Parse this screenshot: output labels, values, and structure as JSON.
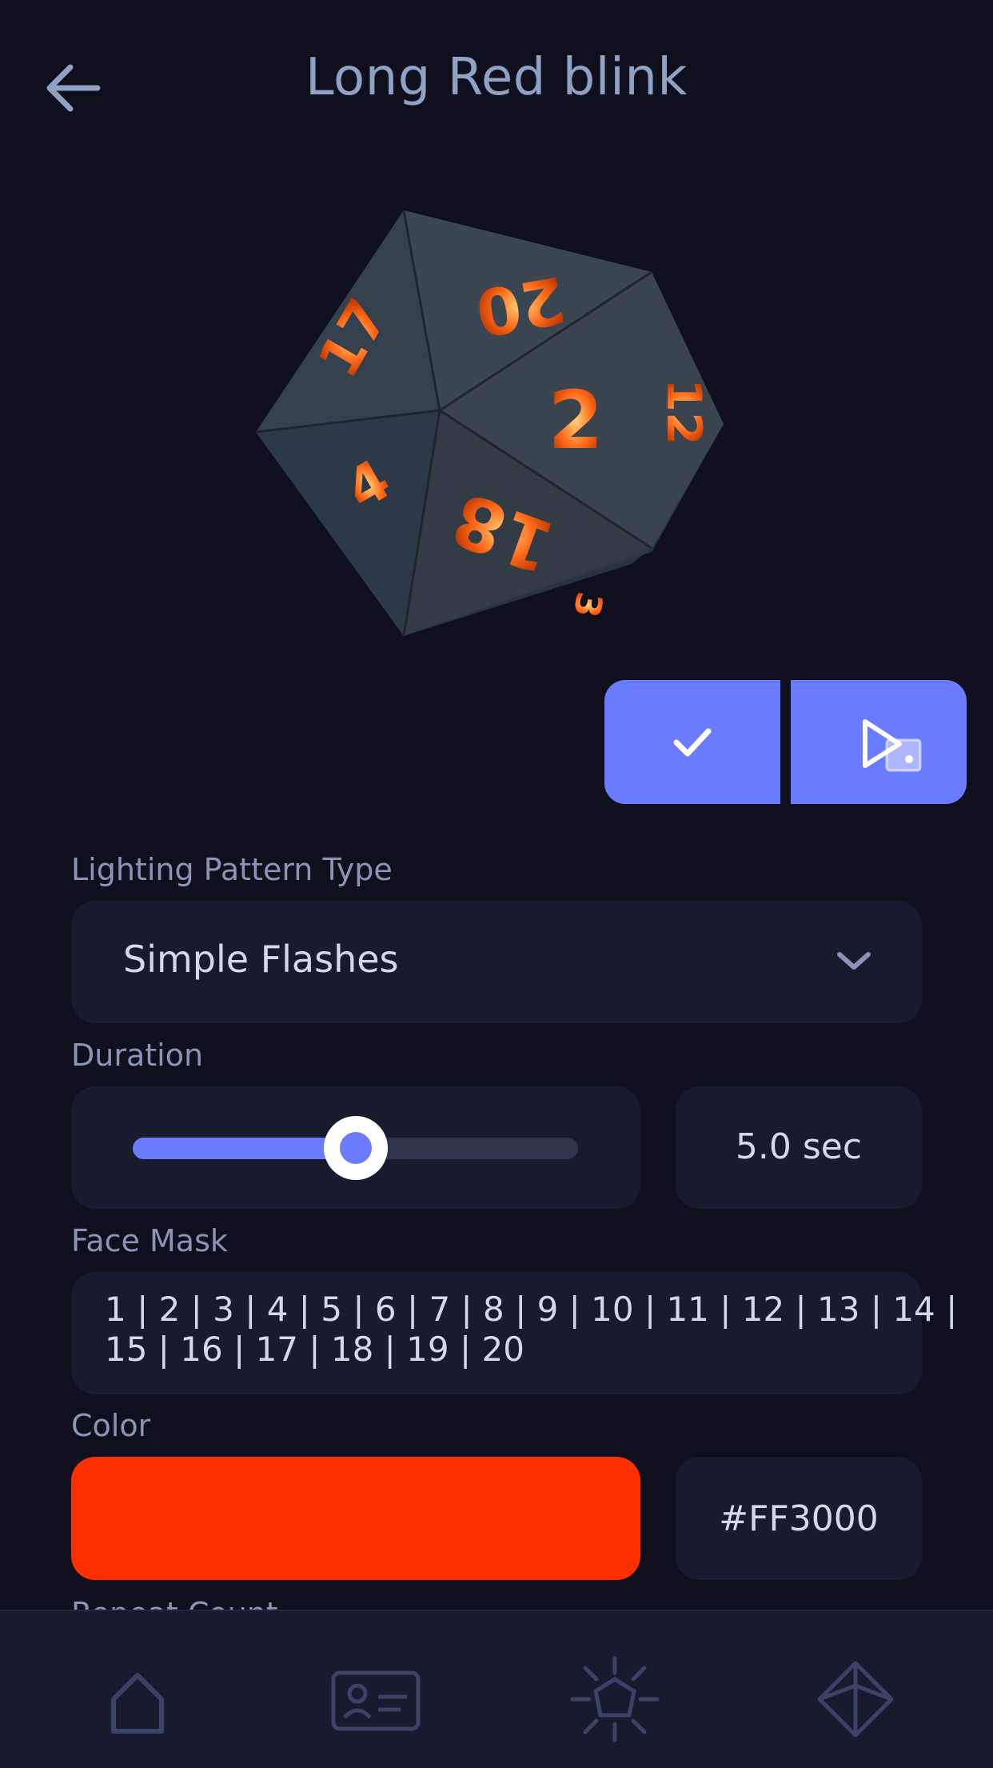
{
  "header": {
    "title": "Long Red blink",
    "back_icon": "arrow-left-icon"
  },
  "preview": {
    "die_type": "d20",
    "visible_numbers": [
      "20",
      "17",
      "2",
      "12",
      "4",
      "18",
      "3"
    ],
    "accent": "#ff6a1a"
  },
  "actions": {
    "apply_icon": "checkmark-icon",
    "roll_icon": "play-die-icon",
    "accent": "#6b7bff"
  },
  "pattern": {
    "label": "Lighting Pattern Type",
    "selected": "Simple Flashes"
  },
  "duration": {
    "label": "Duration",
    "fraction": 0.5,
    "value_text": "5.0 sec"
  },
  "face_mask": {
    "label": "Face Mask",
    "line1": "1 | 2 | 3 | 4 | 5 | 6 | 7 | 8 | 9 | 10 | 11 | 12 | 13 | 14 |",
    "line2": "15 | 16 | 17 | 18 | 19 | 20"
  },
  "color": {
    "label": "Color",
    "value": "#FF3000",
    "hex_text": "#FF3000"
  },
  "next_section_label": "Repeat Count",
  "nav": [
    {
      "id": "home",
      "icon": "home-icon"
    },
    {
      "id": "profile",
      "icon": "id-card-icon"
    },
    {
      "id": "dice-lights",
      "icon": "die-burst-icon"
    },
    {
      "id": "dice",
      "icon": "d8-die-icon"
    }
  ]
}
